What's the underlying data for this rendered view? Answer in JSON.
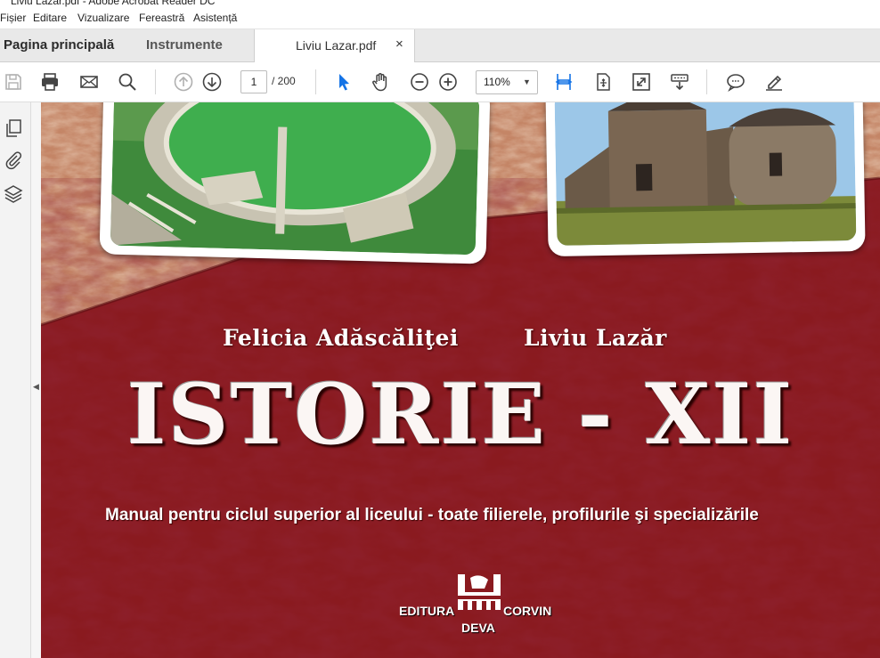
{
  "window": {
    "title": "Liviu Lazar.pdf - Adobe Acrobat Reader DC"
  },
  "menu": [
    "Fișier",
    "Editare",
    "Vizualizare",
    "Fereastră",
    "Asistență"
  ],
  "tabs": {
    "home": "Pagina principală",
    "tools": "Instrumente",
    "document": "Liviu Lazar.pdf",
    "close": "×"
  },
  "toolbar": {
    "icons": [
      "save-icon",
      "print-icon",
      "email-icon",
      "search-icon",
      "page-up-icon",
      "page-down-icon",
      "select-cursor-icon",
      "hand-tool-icon",
      "zoom-out-icon",
      "zoom-in-icon",
      "fit-width-icon",
      "fit-page-icon",
      "fullscreen-icon",
      "read-mode-icon",
      "comment-icon",
      "sign-pen-icon"
    ],
    "current_page": "1",
    "page_total": "/  200",
    "zoom": "110%",
    "accent": "#1473e6"
  },
  "left_panel": {
    "icons": [
      "pages-icon",
      "attachments-icon",
      "layers-icon"
    ]
  },
  "document": {
    "author1": "Felicia Adăscăliţei",
    "author2": "Liviu Lazăr",
    "title": "ISTORIE - XII",
    "subtitle": "Manual pentru ciclul superior al liceului - toate filierele, profilurile şi specializările",
    "publisher_left": "EDITURA",
    "publisher_right": "CORVIN",
    "publisher_city": "DEVA",
    "colors": {
      "cover_red": "#8a1a1f",
      "texture": "#b8755a"
    }
  }
}
